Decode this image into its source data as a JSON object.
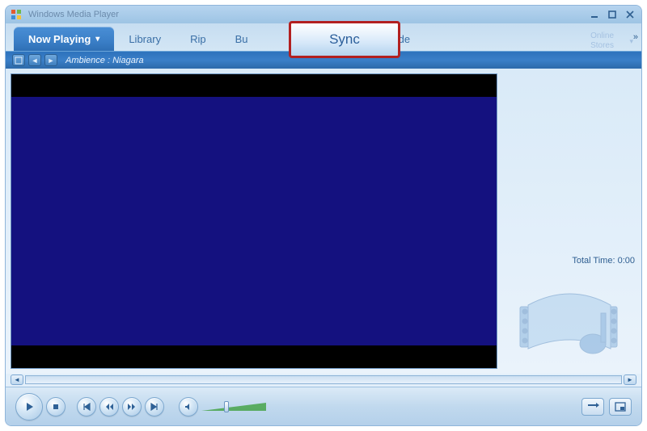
{
  "window": {
    "title": "Windows Media Player"
  },
  "tabs": {
    "now_playing": "Now Playing",
    "library": "Library",
    "rip": "Rip",
    "burn_partial": "Bu",
    "sync_highlight": "Sync",
    "guide_partial": "uide",
    "online_stores_line1": "Online",
    "online_stores_line2": "Stores"
  },
  "subbar": {
    "track_info": "Ambience : Niagara"
  },
  "side": {
    "total_time_label": "Total Time:",
    "total_time_value": "0:00"
  },
  "icons": {
    "min": "minimize",
    "max": "maximize",
    "close": "close"
  }
}
